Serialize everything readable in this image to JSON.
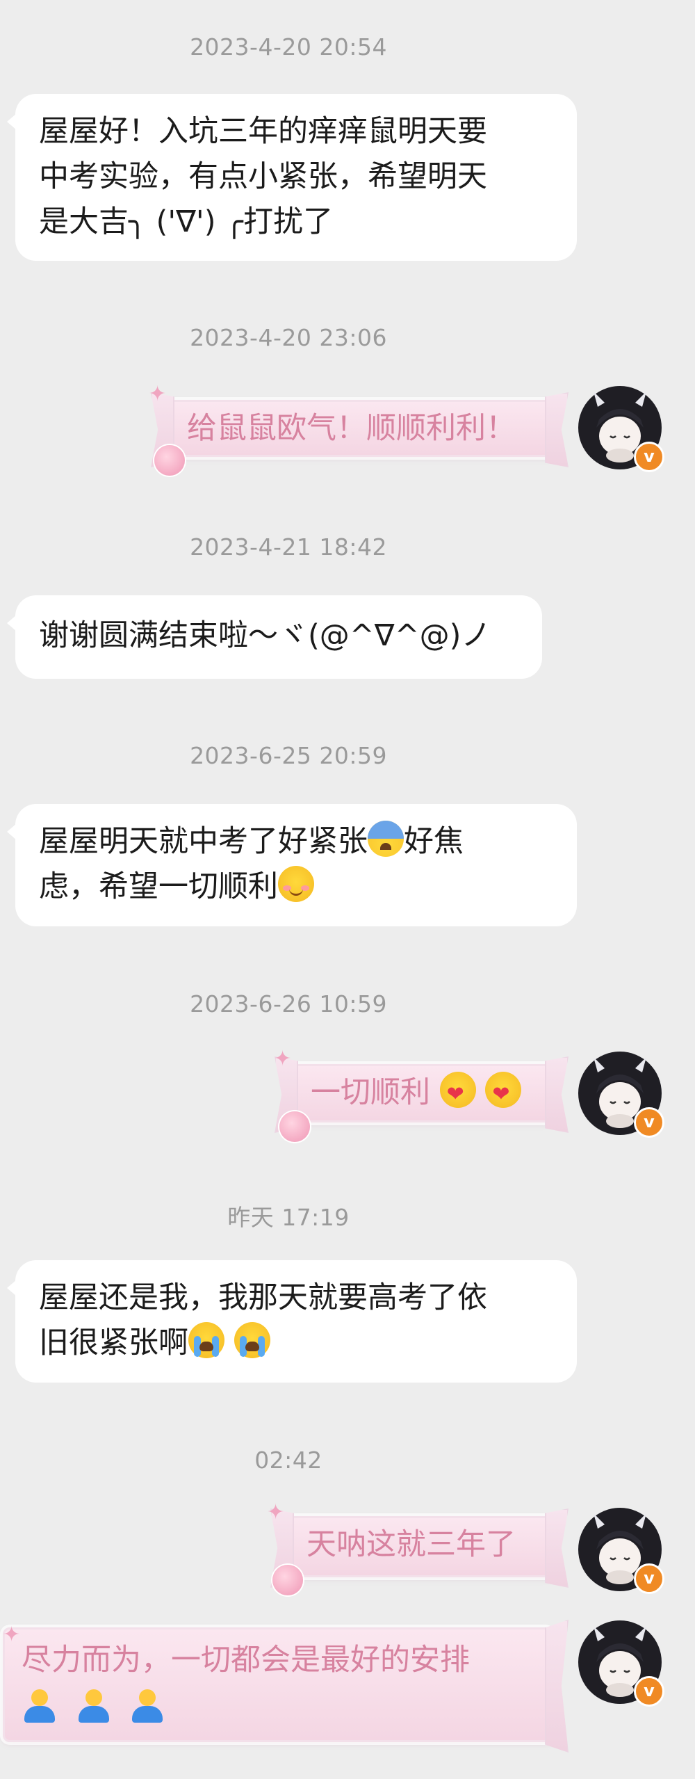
{
  "messages": [
    {
      "timestamp": "2023-4-20 20:54",
      "text_lines": [
        "屋屋好！入坑三年的痒痒鼠明天要",
        "中考实验，有点小紧张，希望明天",
        "是大吉╮ ('∇') ╭打扰了"
      ]
    },
    {
      "timestamp": "2023-4-20 23:06",
      "text": "给鼠鼠欧气！顺顺利利！"
    },
    {
      "timestamp": "2023-4-21 18:42",
      "text": "谢谢圆满结束啦～ヾ(@^∇^@)ノ"
    },
    {
      "timestamp": "2023-6-25 20:59",
      "text_line1": "屋屋明天就中考了好紧张",
      "text_line1b": "好焦",
      "text_line2": "虑，希望一切顺利"
    },
    {
      "timestamp": "2023-6-26 10:59",
      "text": "一切顺利"
    },
    {
      "timestamp": "昨天 17:19",
      "text_line1": "屋屋还是我，我那天就要高考了依",
      "text_line2": "旧很紧张啊"
    },
    {
      "timestamp": "02:42",
      "text": "天呐这就三年了"
    },
    {
      "text": "尽力而为，一切都会是最好的安排"
    }
  ],
  "avatar": {
    "badge": "v"
  },
  "colors": {
    "background": "#ededed",
    "bubble_left": "#ffffff",
    "bubble_right_text": "#d7829f",
    "badge": "#f08a24"
  }
}
